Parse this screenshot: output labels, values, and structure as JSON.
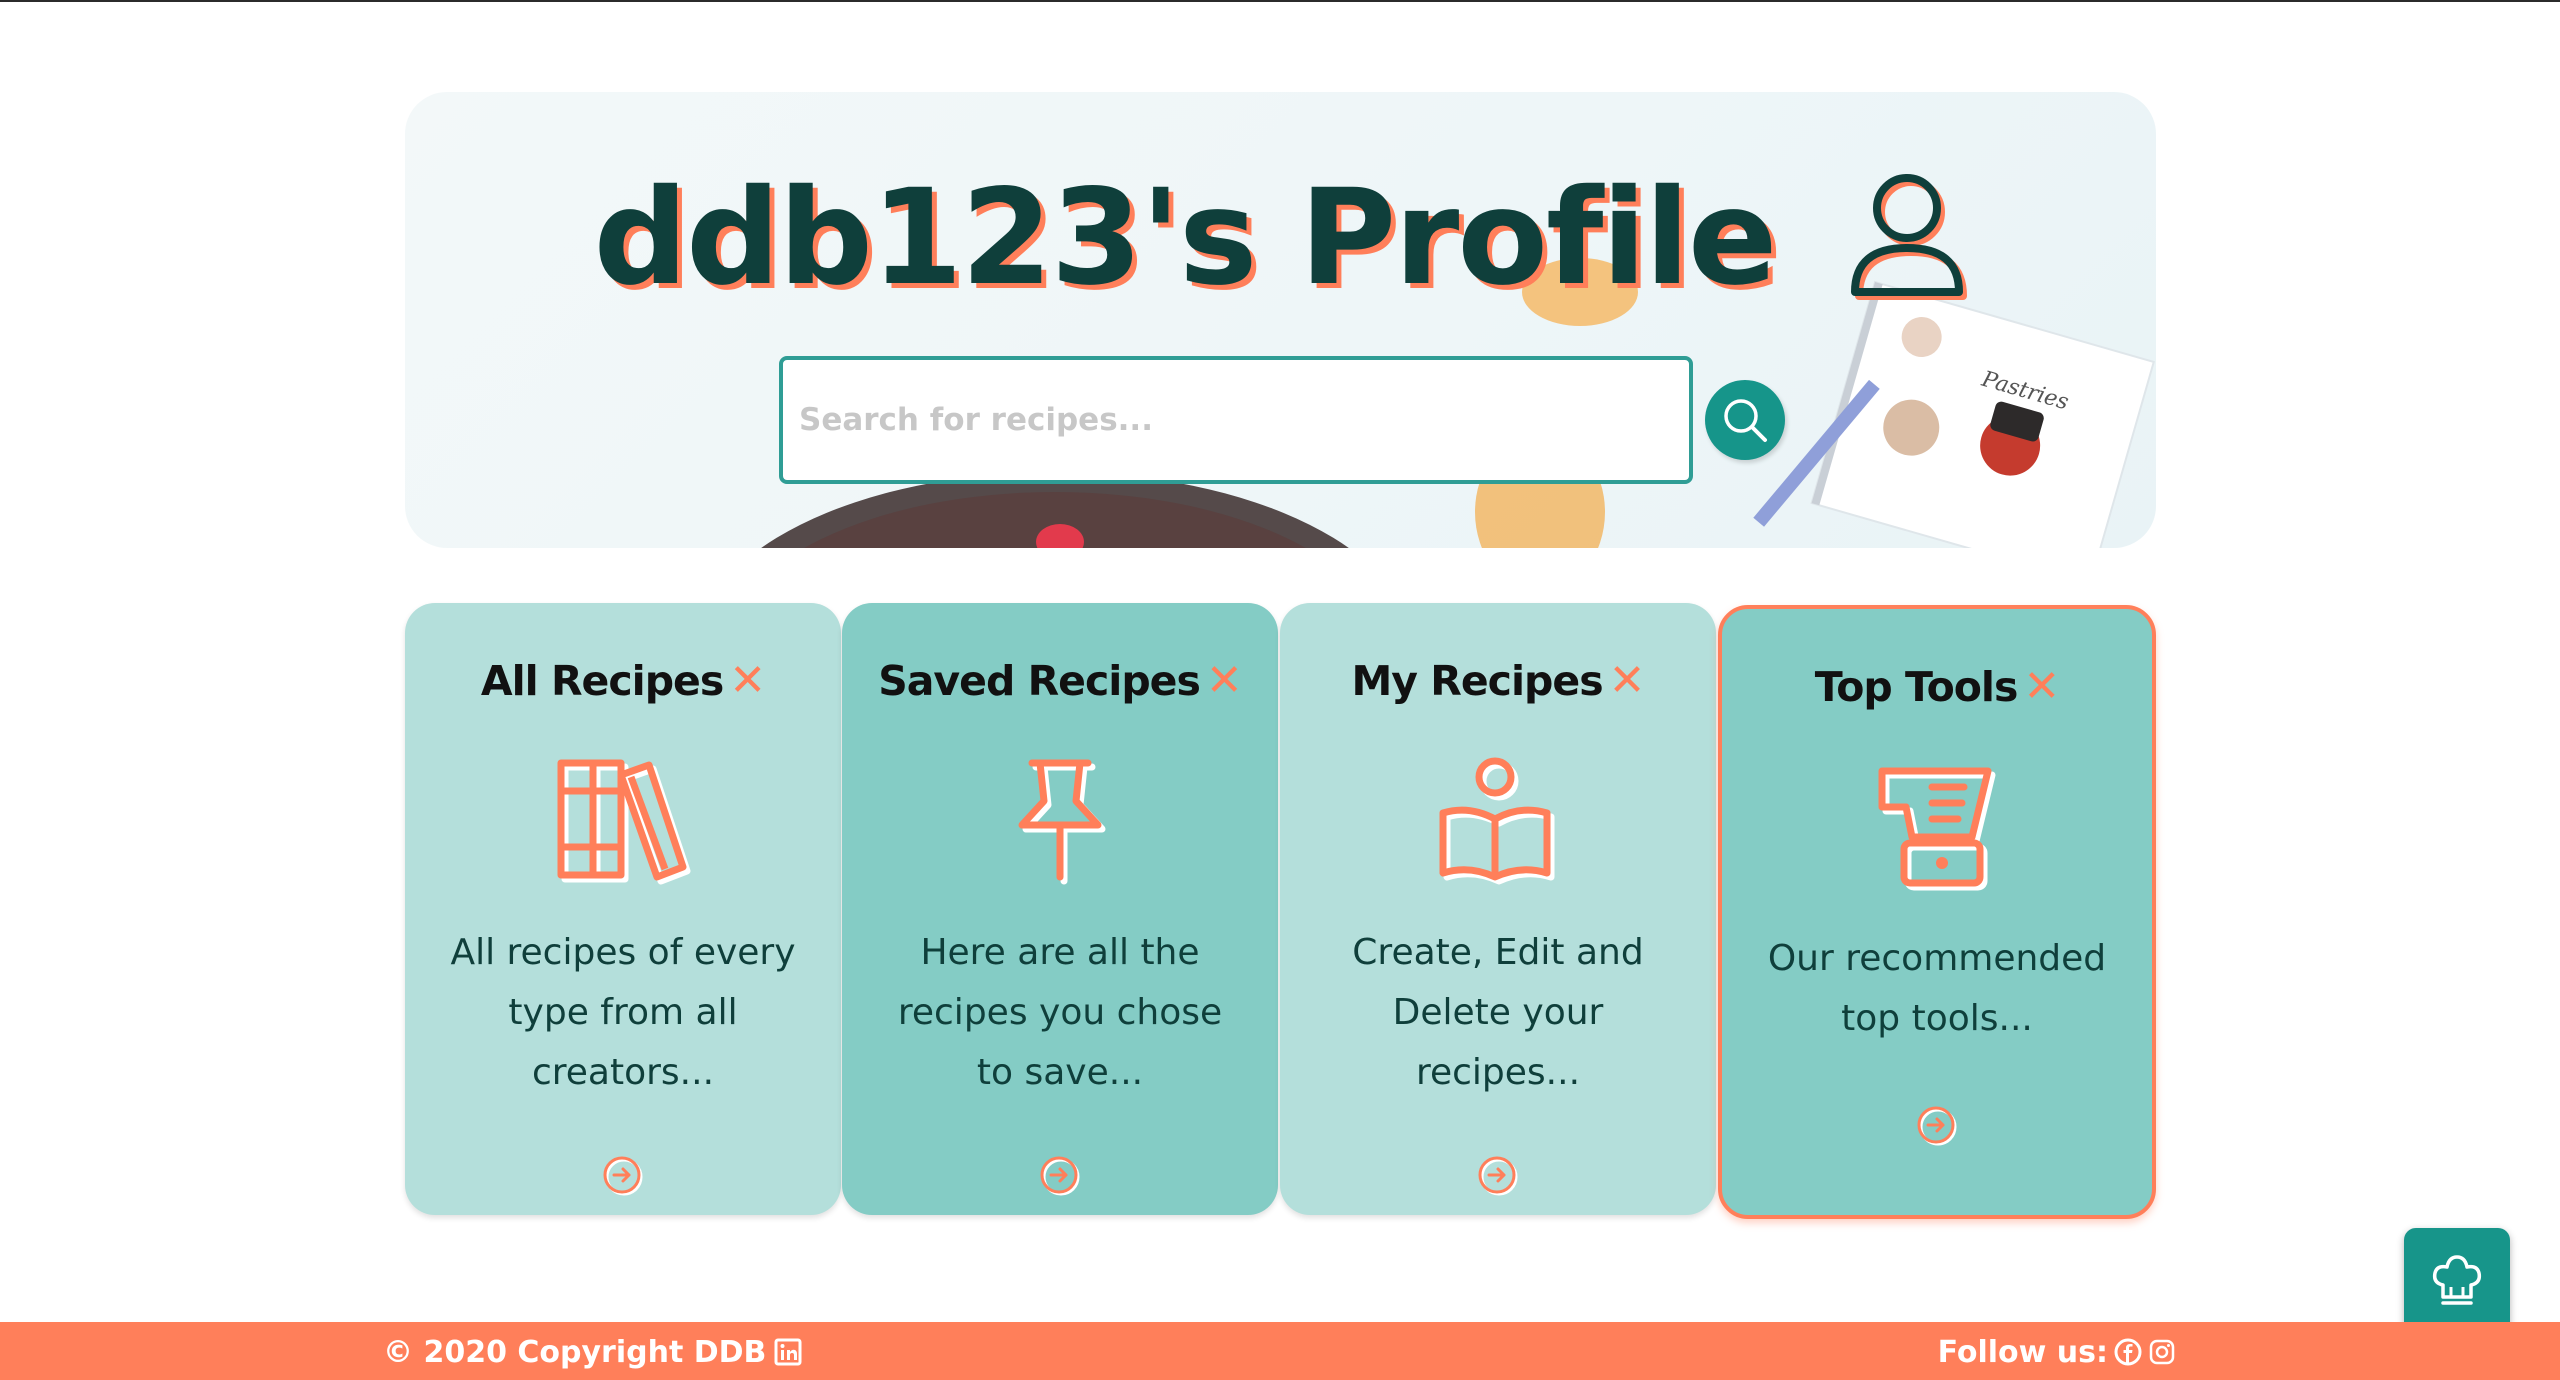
{
  "hero": {
    "title": "ddb123's Profile",
    "user_icon": "user-icon",
    "search": {
      "placeholder": "Search for recipes...",
      "value": "",
      "button_icon": "search-icon"
    }
  },
  "cards": [
    {
      "title": "All Recipes",
      "icon": "books-icon",
      "description": "All recipes of every type from all creators...",
      "arrow_icon": "arrow-right-circle-icon"
    },
    {
      "title": "Saved Recipes",
      "icon": "pin-icon",
      "description": "Here are all the recipes you chose to save...",
      "arrow_icon": "arrow-right-circle-icon"
    },
    {
      "title": "My Recipes",
      "icon": "reader-book-icon",
      "description": "Create, Edit and Delete your recipes...",
      "arrow_icon": "arrow-right-circle-icon"
    },
    {
      "title": "Top Tools",
      "icon": "blender-icon",
      "description": "Our recommended top tools...",
      "arrow_icon": "arrow-right-circle-icon"
    }
  ],
  "title_mark": "✕",
  "chat_button": {
    "icon": "chef-hat-icon"
  },
  "footer": {
    "copyright": "© 2020 Copyright DDB",
    "linkedin_icon": "linkedin-icon",
    "follow_label": "Follow us:",
    "facebook_icon": "facebook-icon",
    "instagram_icon": "instagram-icon"
  },
  "colors": {
    "accent": "#ff7f5a",
    "teal_dark": "#0f3f3b",
    "teal": "#16958a",
    "card_light": "#b4dfdb",
    "card_dark": "#84ccc5"
  }
}
